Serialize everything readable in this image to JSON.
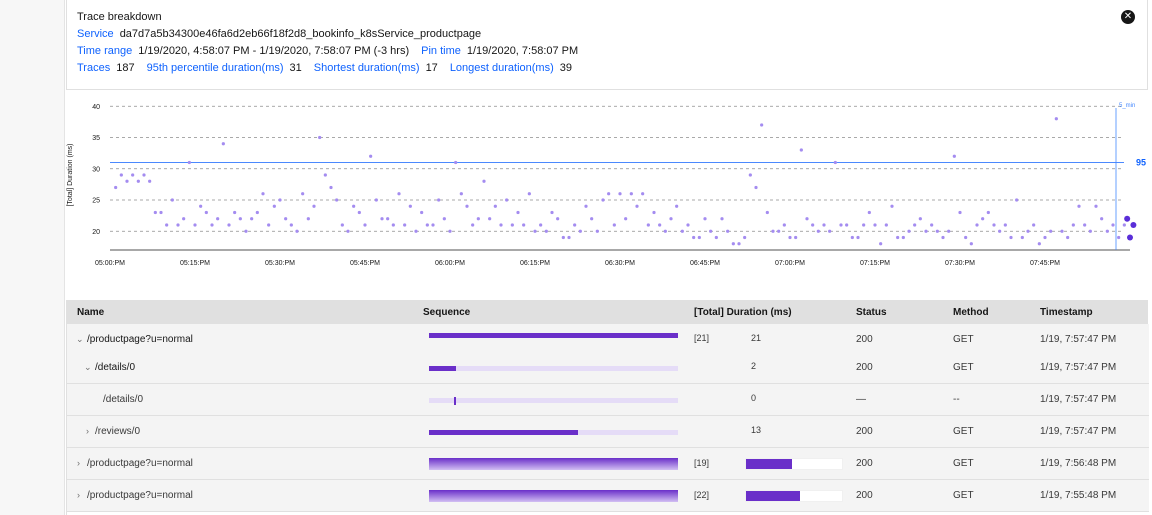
{
  "breakdown": {
    "title": "Trace breakdown",
    "service_label": "Service",
    "service_value": "da7d7a5b34300e46fa6d2eb66f18f2d8_bookinfo_k8sService_productpage",
    "time_range_label": "Time range",
    "time_range_value": "1/19/2020, 4:58:07 PM - 1/19/2020, 7:58:07 PM (-3 hrs)",
    "pin_time_label": "Pin time",
    "pin_time_value": "1/19/2020, 7:58:07 PM",
    "traces_label": "Traces",
    "traces_value": "187",
    "p95_label": "95th percentile duration(ms)",
    "p95_value": "31",
    "shortest_label": "Shortest duration(ms)",
    "shortest_value": "17",
    "longest_label": "Longest duration(ms)",
    "longest_value": "39",
    "close_icon": "close-icon"
  },
  "chart_data": {
    "type": "scatter",
    "ylabel": "[Total] Duration (ms)",
    "xlabel": "",
    "ylim": [
      17,
      41
    ],
    "yticks": [
      20,
      25,
      30,
      35,
      40
    ],
    "x_tick_labels": [
      "05:00:PM",
      "05:15:PM",
      "05:30:PM",
      "05:45:PM",
      "06:00:PM",
      "06:15:PM",
      "06:30:PM",
      "06:45:PM",
      "07:00:PM",
      "07:15:PM",
      "07:30:PM",
      "07:45:PM"
    ],
    "x_range_minutes": [
      0,
      180
    ],
    "grid": "dashed horizontal",
    "percentile_line": {
      "label": "95",
      "value": 31
    },
    "pin_marker_label": "5_min",
    "point_color": "#a48cf0",
    "highlight_color": "#5a2ed8",
    "points": [
      [
        1,
        27
      ],
      [
        2,
        29
      ],
      [
        3,
        28
      ],
      [
        4,
        29
      ],
      [
        5,
        28
      ],
      [
        6,
        29
      ],
      [
        7,
        28
      ],
      [
        8,
        23
      ],
      [
        9,
        23
      ],
      [
        10,
        21
      ],
      [
        11,
        25
      ],
      [
        12,
        21
      ],
      [
        13,
        22
      ],
      [
        14,
        31
      ],
      [
        15,
        21
      ],
      [
        16,
        24
      ],
      [
        17,
        23
      ],
      [
        18,
        21
      ],
      [
        19,
        22
      ],
      [
        20,
        34
      ],
      [
        21,
        21
      ],
      [
        22,
        23
      ],
      [
        23,
        22
      ],
      [
        24,
        20
      ],
      [
        25,
        22
      ],
      [
        26,
        23
      ],
      [
        27,
        26
      ],
      [
        28,
        21
      ],
      [
        29,
        24
      ],
      [
        30,
        25
      ],
      [
        31,
        22
      ],
      [
        32,
        21
      ],
      [
        33,
        20
      ],
      [
        34,
        26
      ],
      [
        35,
        22
      ],
      [
        36,
        24
      ],
      [
        37,
        35
      ],
      [
        38,
        29
      ],
      [
        39,
        27
      ],
      [
        40,
        25
      ],
      [
        41,
        21
      ],
      [
        42,
        20
      ],
      [
        43,
        24
      ],
      [
        44,
        23
      ],
      [
        45,
        21
      ],
      [
        46,
        32
      ],
      [
        47,
        25
      ],
      [
        48,
        22
      ],
      [
        49,
        22
      ],
      [
        50,
        21
      ],
      [
        51,
        26
      ],
      [
        52,
        21
      ],
      [
        53,
        24
      ],
      [
        54,
        20
      ],
      [
        55,
        23
      ],
      [
        56,
        21
      ],
      [
        57,
        21
      ],
      [
        58,
        25
      ],
      [
        59,
        22
      ],
      [
        60,
        20
      ],
      [
        61,
        31
      ],
      [
        62,
        26
      ],
      [
        63,
        24
      ],
      [
        64,
        21
      ],
      [
        65,
        22
      ],
      [
        66,
        28
      ],
      [
        67,
        22
      ],
      [
        68,
        24
      ],
      [
        69,
        21
      ],
      [
        70,
        25
      ],
      [
        71,
        21
      ],
      [
        72,
        23
      ],
      [
        73,
        21
      ],
      [
        74,
        26
      ],
      [
        75,
        20
      ],
      [
        76,
        21
      ],
      [
        77,
        20
      ],
      [
        78,
        23
      ],
      [
        79,
        22
      ],
      [
        80,
        19
      ],
      [
        81,
        19
      ],
      [
        82,
        21
      ],
      [
        83,
        20
      ],
      [
        84,
        24
      ],
      [
        85,
        22
      ],
      [
        86,
        20
      ],
      [
        87,
        25
      ],
      [
        88,
        26
      ],
      [
        89,
        21
      ],
      [
        90,
        26
      ],
      [
        91,
        22
      ],
      [
        92,
        26
      ],
      [
        93,
        24
      ],
      [
        94,
        26
      ],
      [
        95,
        21
      ],
      [
        96,
        23
      ],
      [
        97,
        21
      ],
      [
        98,
        20
      ],
      [
        99,
        22
      ],
      [
        100,
        24
      ],
      [
        101,
        20
      ],
      [
        102,
        21
      ],
      [
        103,
        19
      ],
      [
        104,
        19
      ],
      [
        105,
        22
      ],
      [
        106,
        20
      ],
      [
        107,
        19
      ],
      [
        108,
        22
      ],
      [
        109,
        20
      ],
      [
        110,
        18
      ],
      [
        111,
        18
      ],
      [
        112,
        19
      ],
      [
        113,
        29
      ],
      [
        114,
        27
      ],
      [
        115,
        37
      ],
      [
        116,
        23
      ],
      [
        117,
        20
      ],
      [
        118,
        20
      ],
      [
        119,
        21
      ],
      [
        120,
        19
      ],
      [
        121,
        19
      ],
      [
        122,
        33
      ],
      [
        123,
        22
      ],
      [
        124,
        21
      ],
      [
        125,
        20
      ],
      [
        126,
        21
      ],
      [
        127,
        20
      ],
      [
        128,
        31
      ],
      [
        129,
        21
      ],
      [
        130,
        21
      ],
      [
        131,
        19
      ],
      [
        132,
        19
      ],
      [
        133,
        21
      ],
      [
        134,
        23
      ],
      [
        135,
        21
      ],
      [
        136,
        18
      ],
      [
        137,
        21
      ],
      [
        138,
        24
      ],
      [
        139,
        19
      ],
      [
        140,
        19
      ],
      [
        141,
        20
      ],
      [
        142,
        21
      ],
      [
        143,
        22
      ],
      [
        144,
        20
      ],
      [
        145,
        21
      ],
      [
        146,
        20
      ],
      [
        147,
        19
      ],
      [
        148,
        20
      ],
      [
        149,
        32
      ],
      [
        150,
        23
      ],
      [
        151,
        19
      ],
      [
        152,
        18
      ],
      [
        153,
        21
      ],
      [
        154,
        22
      ],
      [
        155,
        23
      ],
      [
        156,
        21
      ],
      [
        157,
        20
      ],
      [
        158,
        21
      ],
      [
        159,
        19
      ],
      [
        160,
        25
      ],
      [
        161,
        19
      ],
      [
        162,
        20
      ],
      [
        163,
        21
      ],
      [
        164,
        18
      ],
      [
        165,
        19
      ],
      [
        166,
        20
      ],
      [
        167,
        38
      ],
      [
        168,
        20
      ],
      [
        169,
        19
      ],
      [
        170,
        21
      ],
      [
        171,
        24
      ],
      [
        172,
        21
      ],
      [
        173,
        20
      ],
      [
        174,
        24
      ],
      [
        175,
        22
      ],
      [
        176,
        20
      ],
      [
        177,
        21
      ],
      [
        178,
        19
      ],
      [
        179,
        21
      ]
    ],
    "highlight_points": [
      [
        179.5,
        22
      ],
      [
        180,
        19
      ],
      [
        180.6,
        21
      ]
    ]
  },
  "table": {
    "headers": [
      "Name",
      "Sequence",
      "[Total] Duration (ms)",
      "Status",
      "Method",
      "Timestamp"
    ],
    "rows": [
      {
        "name": "/productpage?u=normal",
        "bracket": "[21]",
        "duration": "21",
        "status": "200",
        "method": "GET",
        "timestamp": "1/19, 7:57:47 PM"
      },
      {
        "name": "/details/0",
        "bracket": "",
        "duration": "2",
        "status": "200",
        "method": "GET",
        "timestamp": "1/19, 7:57:47 PM"
      },
      {
        "name": "/details/0",
        "bracket": "",
        "duration": "0",
        "status": "—",
        "method": "--",
        "timestamp": "1/19, 7:57:47 PM"
      },
      {
        "name": "/reviews/0",
        "bracket": "",
        "duration": "13",
        "status": "200",
        "method": "GET",
        "timestamp": "1/19, 7:57:47 PM"
      },
      {
        "name": "/productpage?u=normal",
        "bracket": "[19]",
        "duration": "",
        "status": "200",
        "method": "GET",
        "timestamp": "1/19, 7:56:48 PM"
      },
      {
        "name": "/productpage?u=normal",
        "bracket": "[22]",
        "duration": "",
        "status": "200",
        "method": "GET",
        "timestamp": "1/19, 7:55:48 PM"
      }
    ],
    "sequence": [
      {
        "start": 0.0,
        "fill": 1.0
      },
      {
        "start": 0.0,
        "fill": 0.11
      },
      {
        "start": 0.1,
        "fill": 0.01
      },
      {
        "start": 0.0,
        "fill": 0.6
      },
      {
        "start": 0.0,
        "fill": 1.0
      },
      {
        "start": 0.0,
        "fill": 1.0
      }
    ],
    "duration_fraction": [
      null,
      null,
      null,
      null,
      0.48,
      0.56
    ]
  }
}
